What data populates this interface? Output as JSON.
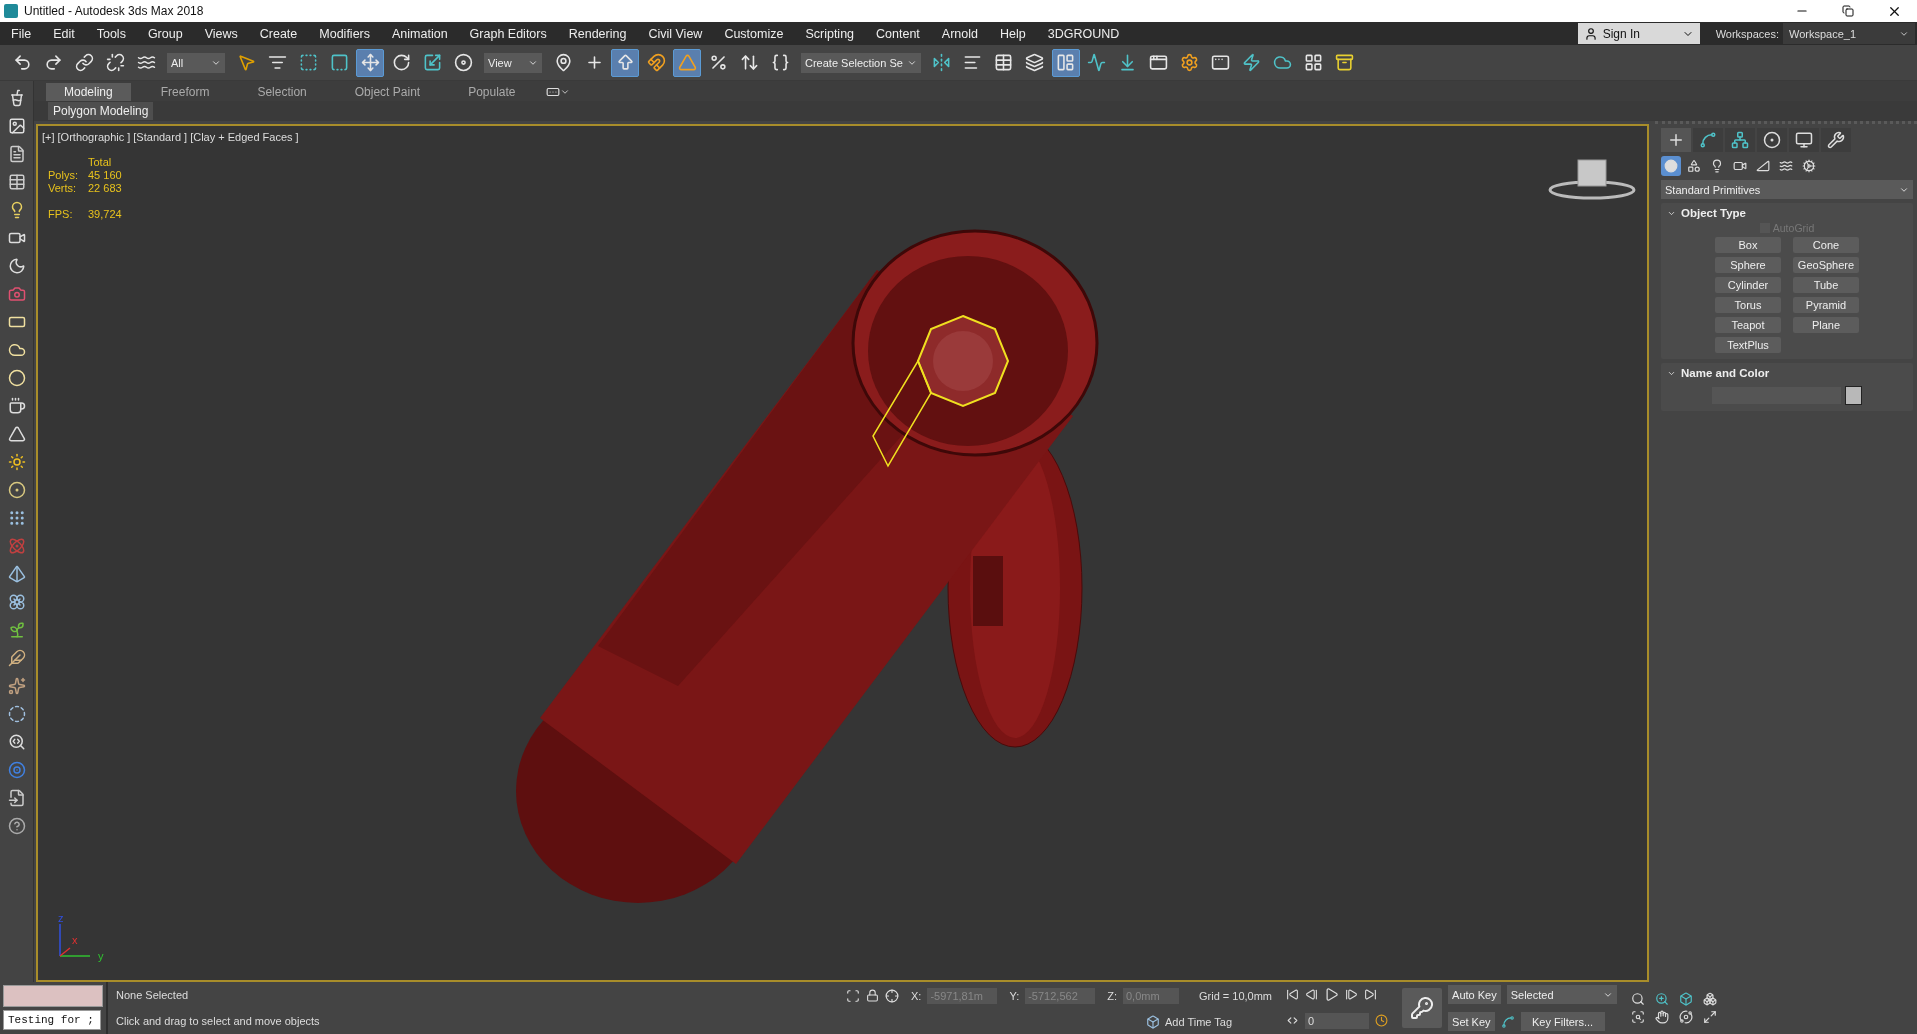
{
  "window": {
    "title": "Untitled - Autodesk 3ds Max 2018"
  },
  "menu": [
    "File",
    "Edit",
    "Tools",
    "Group",
    "Views",
    "Create",
    "Modifiers",
    "Animation",
    "Graph Editors",
    "Rendering",
    "Civil View",
    "Customize",
    "Scripting",
    "Content",
    "Arnold",
    "Help",
    "3DGROUND"
  ],
  "account": {
    "label": "Sign In"
  },
  "workspaces": {
    "label": "Workspaces:",
    "value": "Workspace_1"
  },
  "toolbar": [
    {
      "kind": "button",
      "selected": false
    },
    {
      "kind": "button",
      "selected": false
    },
    {
      "kind": "button",
      "selected": false
    },
    {
      "kind": "button",
      "selected": false
    },
    {
      "kind": "button",
      "selected": false
    },
    {
      "kind": "dropdown",
      "value": "All"
    },
    {
      "kind": "button",
      "selected": false
    },
    {
      "kind": "button",
      "selected": false
    },
    {
      "kind": "button",
      "selected": false
    },
    {
      "kind": "button",
      "selected": false
    },
    {
      "kind": "button",
      "selected": true
    },
    {
      "kind": "button",
      "selected": false
    },
    {
      "kind": "button",
      "selected": false
    },
    {
      "kind": "button",
      "selected": false
    },
    {
      "kind": "dropdown",
      "value": "View"
    },
    {
      "kind": "button",
      "selected": false
    },
    {
      "kind": "button",
      "selected": false
    },
    {
      "kind": "button",
      "selected": true
    },
    {
      "kind": "button",
      "selected": false
    },
    {
      "kind": "button",
      "selected": true
    },
    {
      "kind": "button",
      "selected": false
    },
    {
      "kind": "button",
      "selected": false
    },
    {
      "kind": "button",
      "selected": false
    },
    {
      "kind": "dropdown",
      "value": "Create Selection Se"
    },
    {
      "kind": "button",
      "selected": false
    },
    {
      "kind": "button",
      "selected": false
    },
    {
      "kind": "button",
      "selected": false
    },
    {
      "kind": "button",
      "selected": false
    },
    {
      "kind": "button",
      "selected": true
    },
    {
      "kind": "button",
      "selected": false
    },
    {
      "kind": "button",
      "selected": false
    },
    {
      "kind": "button",
      "selected": false
    },
    {
      "kind": "button",
      "selected": false
    },
    {
      "kind": "button",
      "selected": false
    },
    {
      "kind": "button",
      "selected": false
    },
    {
      "kind": "button",
      "selected": false
    },
    {
      "kind": "button",
      "selected": false
    },
    {
      "kind": "button",
      "selected": false
    }
  ],
  "ribbon": {
    "tabs": [
      {
        "label": "Modeling",
        "selected": true
      },
      {
        "label": "Freeform",
        "selected": false
      },
      {
        "label": "Selection",
        "selected": false
      },
      {
        "label": "Object Paint",
        "selected": false
      },
      {
        "label": "Populate",
        "selected": false
      }
    ],
    "panel": "Polygon Modeling"
  },
  "viewport": {
    "labels": [
      "[+]",
      "[Orthographic ]",
      "[Standard ]",
      "[Clay + Edged Faces ]"
    ],
    "stats_header": "Total",
    "stats": [
      {
        "label": "Polys:",
        "value": "45 160"
      },
      {
        "label": "Verts:",
        "value": "22 683"
      }
    ],
    "fps": {
      "label": "FPS:",
      "value": "39,724"
    },
    "axis_labels": [
      "z",
      "x",
      "y"
    ]
  },
  "command_panel": {
    "tabs": [
      {
        "selected": true
      },
      {
        "selected": false
      },
      {
        "selected": false
      },
      {
        "selected": false
      },
      {
        "selected": false
      },
      {
        "selected": false
      }
    ],
    "categories": [
      {
        "selected": true
      },
      {
        "selected": false
      },
      {
        "selected": false
      },
      {
        "selected": false
      },
      {
        "selected": false
      },
      {
        "selected": false
      },
      {
        "selected": false
      }
    ],
    "dropdown": "Standard Primitives",
    "object_type": {
      "title": "Object Type",
      "autogrid": {
        "label": "AutoGrid",
        "checked": false,
        "disabled": true
      },
      "buttons": [
        "Box",
        "Cone",
        "Sphere",
        "GeoSphere",
        "Cylinder",
        "Tube",
        "Torus",
        "Pyramid",
        "Teapot",
        "Plane",
        "TextPlus"
      ]
    },
    "name_and_color": {
      "title": "Name and Color"
    }
  },
  "status_bar": {
    "listener_input": "Testing for ;",
    "selection": "None Selected",
    "prompt": "Click and drag to select and move objects",
    "coords": [
      {
        "label": "X:",
        "value": "-5971,81m",
        "disabled": true
      },
      {
        "label": "Y:",
        "value": "-5712,562",
        "disabled": true
      },
      {
        "label": "Z:",
        "value": "0,0mm",
        "disabled": true
      }
    ],
    "grid": "Grid = 10,0mm",
    "time_tag": "Add Time Tag",
    "frame": "0",
    "auto_key": "Auto Key",
    "key_mode": "Selected",
    "set_key": "Set Key",
    "key_filters": "Key Filters..."
  }
}
